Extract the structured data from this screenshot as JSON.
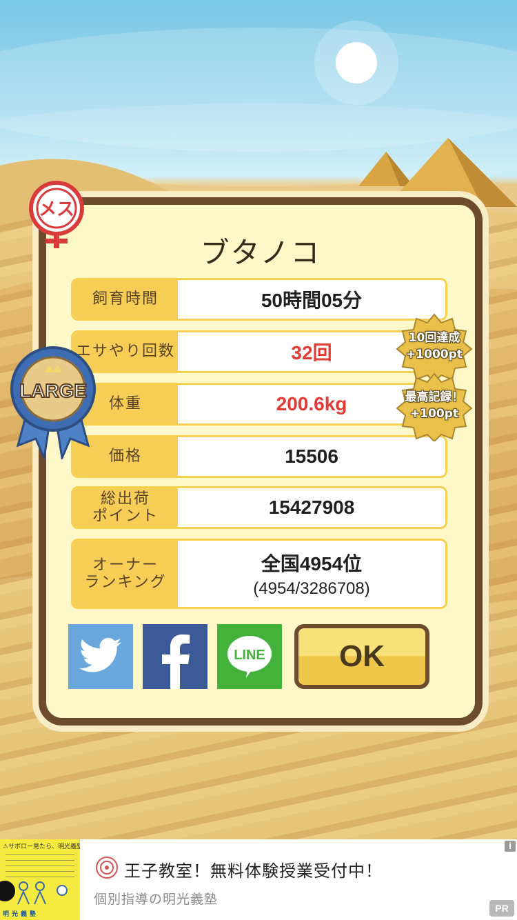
{
  "pig": {
    "name": "ブタノコ",
    "gender_badge": "メス",
    "size_badge": "LARGE"
  },
  "stats": [
    {
      "label": "飼育時間",
      "value": "50時間05分",
      "highlight": false
    },
    {
      "label": "エサやり回数",
      "value": "32回",
      "highlight": true
    },
    {
      "label": "体重",
      "value": "200.6kg",
      "highlight": true
    },
    {
      "label": "価格",
      "value": "15506",
      "highlight": false
    },
    {
      "label": "総出荷\nポイント",
      "value": "15427908",
      "highlight": false
    },
    {
      "label": "オーナー\nランキング",
      "value": "全国4954位",
      "sub": "(4954/3286708)",
      "highlight": false
    }
  ],
  "bonuses": [
    {
      "line1": "10回達成",
      "line2": "+1000pt"
    },
    {
      "line1": "最高記録！",
      "line2": "+100pt"
    }
  ],
  "share": {
    "twitter_icon": "twitter-bird-icon",
    "facebook_icon": "facebook-f-icon",
    "line_label": "LINE"
  },
  "ok_label": "OK",
  "ad": {
    "title": "王子教室！無料体験授業受付中！",
    "subtitle": "個別指導の明光義塾",
    "image_caption": "⚠サボロー見たら、明光義塾。",
    "image_footer": "明光義塾",
    "pr_label": "PR",
    "info_label": "i"
  },
  "colors": {
    "highlight_red": "#e23b35",
    "frame_brown": "#6d4b2c",
    "panel_cream": "#fff9c9",
    "label_yellow": "#f6ce55",
    "twitter_blue": "#69a7dd",
    "facebook_blue": "#3c5a98",
    "line_green": "#43b23a"
  }
}
